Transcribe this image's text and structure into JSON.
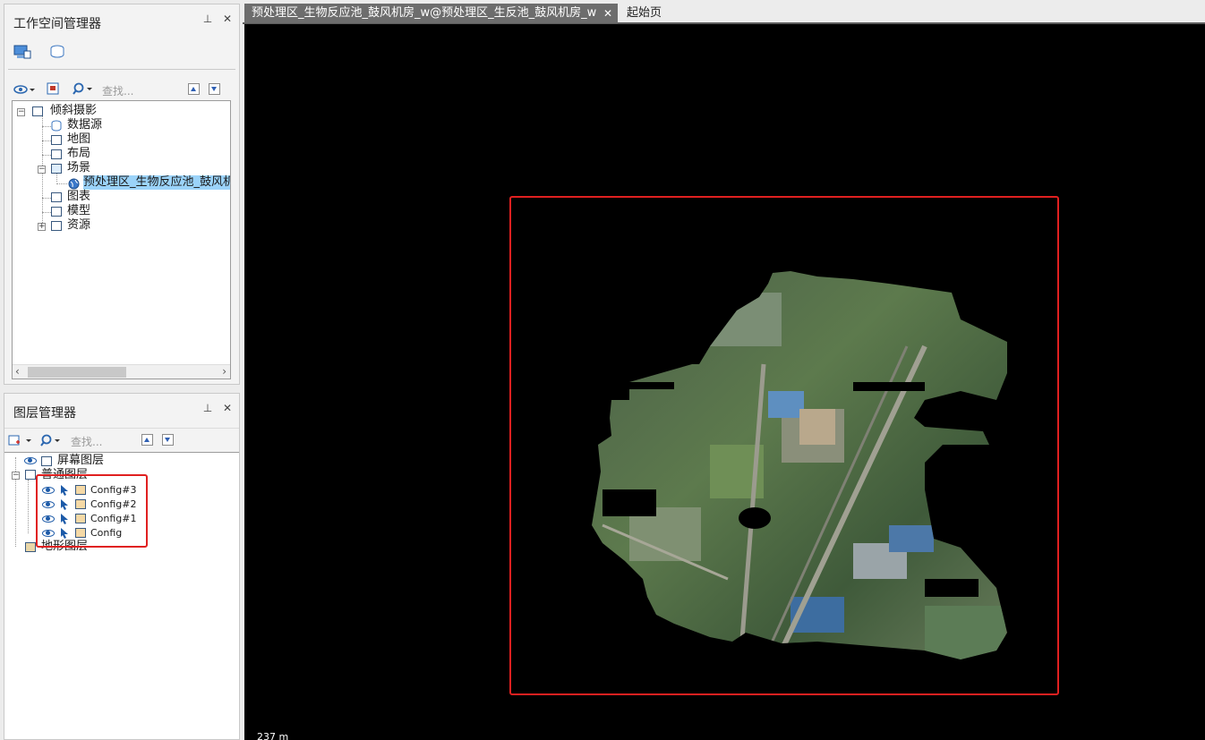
{
  "workspace": {
    "title": "工作空间管理器",
    "pin_icon": "pin-icon",
    "close_icon": "close-icon",
    "search_placeholder": "查找...",
    "tree": {
      "root": "倾斜摄影",
      "items": [
        "数据源",
        "地图",
        "布局",
        "场景",
        "图表",
        "模型",
        "资源"
      ],
      "scene_child": "预处理区_生物反应池_鼓风机"
    }
  },
  "layers": {
    "title": "图层管理器",
    "search_placeholder": "查找...",
    "screen_layer": "屏幕图层",
    "normal_layer": "普通图层",
    "configs": [
      "Config#3",
      "Config#2",
      "Config#1",
      "Config"
    ],
    "terrain_layer": "地形图层"
  },
  "tabs": [
    {
      "label": "预处理区_生物反应池_鼓风机房_w@预处理区_生反池_鼓风机房_w",
      "active": true
    },
    {
      "label": "起始页",
      "active": false
    }
  ],
  "scale_text": "237 m",
  "colors": {
    "highlight_red": "#e02020",
    "selection": "#9bd3f9",
    "map_bg": "#000000"
  }
}
